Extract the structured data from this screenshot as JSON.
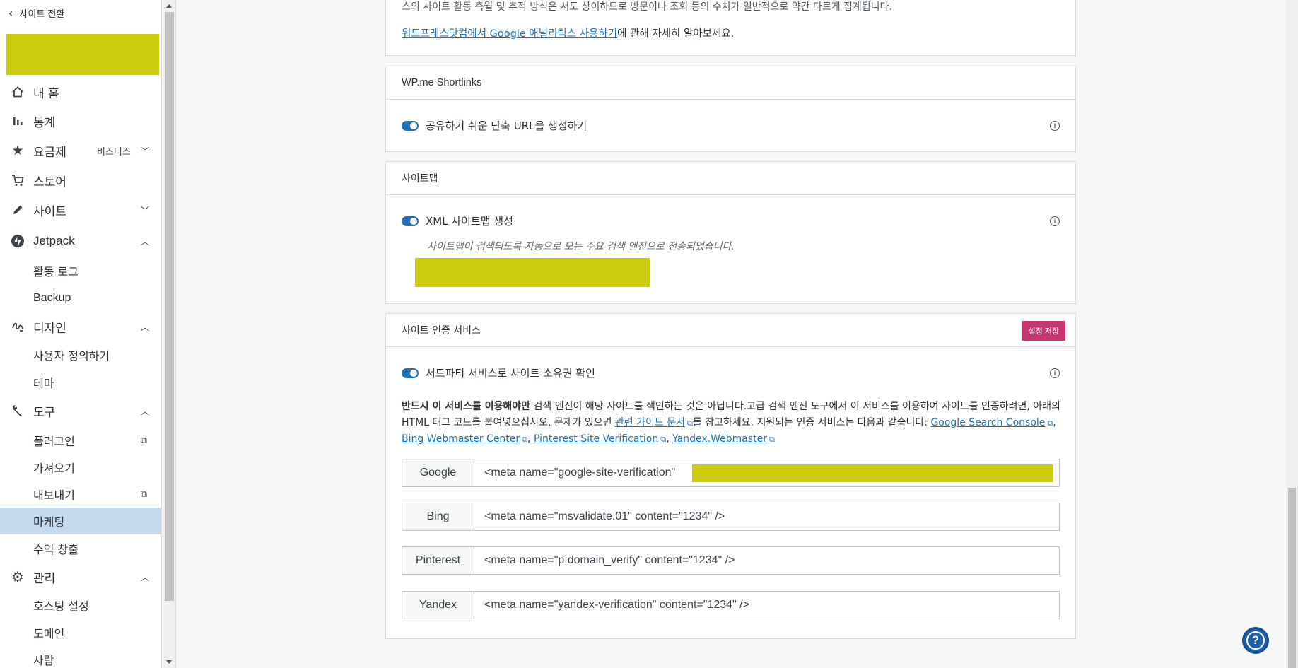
{
  "sidebar": {
    "switch_site": "사이트 전환",
    "items": [
      {
        "label": "내 홈",
        "icon": "home-icon"
      },
      {
        "label": "통계",
        "icon": "stats-icon"
      },
      {
        "label": "요금제",
        "icon": "star-icon",
        "badge": "비즈니스"
      },
      {
        "label": "스토어",
        "icon": "cart-icon"
      },
      {
        "label": "사이트",
        "icon": "pencil-icon"
      },
      {
        "label": "Jetpack",
        "icon": "jetpack-icon"
      },
      {
        "label": "활동 로그"
      },
      {
        "label": "Backup"
      },
      {
        "label": "디자인",
        "icon": "design-icon"
      },
      {
        "label": "사용자 정의하기"
      },
      {
        "label": "테마"
      },
      {
        "label": "도구",
        "icon": "wrench-icon"
      },
      {
        "label": "플러그인"
      },
      {
        "label": "가져오기"
      },
      {
        "label": "내보내기"
      },
      {
        "label": "마케팅"
      },
      {
        "label": "수익 창출"
      },
      {
        "label": "관리",
        "icon": "gear-icon"
      },
      {
        "label": "호스팅 설정"
      },
      {
        "label": "도메인"
      },
      {
        "label": "사람"
      }
    ]
  },
  "analytics_card": {
    "partial_text": "스의 사이트 활동 측월 및 추적 방식은 서도 상이하므로 방문이나 조회 등의 수치가 일반적으로 약간 다르게 집계됩니다.",
    "link_text": "워드프레스닷컴에서 Google 애널리틱스 사용하기",
    "link_suffix": "에 관해 자세히 알아보세요."
  },
  "shortlinks_card": {
    "title": "WP.me Shortlinks",
    "toggle_label": "공유하기 쉬운 단축 URL을 생성하기"
  },
  "sitemap_card": {
    "title": "사이트맵",
    "toggle_label": "XML 사이트맵 생성",
    "note": "사이트맵이 검색되도록 자동으로 모든 주요 검색 엔진으로 전송되었습니다."
  },
  "verification_card": {
    "title": "사이트 인증 서비스",
    "save_button": "설정 저장",
    "toggle_label": "서드파티 서비스로 사이트 소유권 확인",
    "desc_bold": "반드시 이 서비스를 이용해야만",
    "desc_text1": " 검색 엔진이 해당 사이트를 색인하는 것은 아닙니다.고급 검색 엔진 도구에서 이 서비스를 이용하여 사이트를 인증하려면, 아래의 HTML 태그 코드를 붙여넣으십시오. 문제가 있으면 ",
    "guide_link": "관련 가이드 문서",
    "desc_text2": "를 참고하세요. 지원되는 인증 서비스는 다음과 같습니다: ",
    "services_links": [
      "Google Search Console",
      "Bing Webmaster Center",
      "Pinterest Site Verification",
      "Yandex.Webmaster"
    ],
    "rows": [
      {
        "service": "Google",
        "value": "<meta name=\"google-site-verification\""
      },
      {
        "service": "Bing",
        "value": "<meta name=\"msvalidate.01\" content=\"1234\" />"
      },
      {
        "service": "Pinterest",
        "value": "<meta name=\"p:domain_verify\" content=\"1234\" />"
      },
      {
        "service": "Yandex",
        "value": "<meta name=\"yandex-verification\" content=\"1234\" />"
      }
    ]
  },
  "colors": {
    "accent": "#2271b1",
    "save_button": "#c9356e",
    "active_nav": "#c5d9ed",
    "redaction": "#cdcc0c"
  }
}
